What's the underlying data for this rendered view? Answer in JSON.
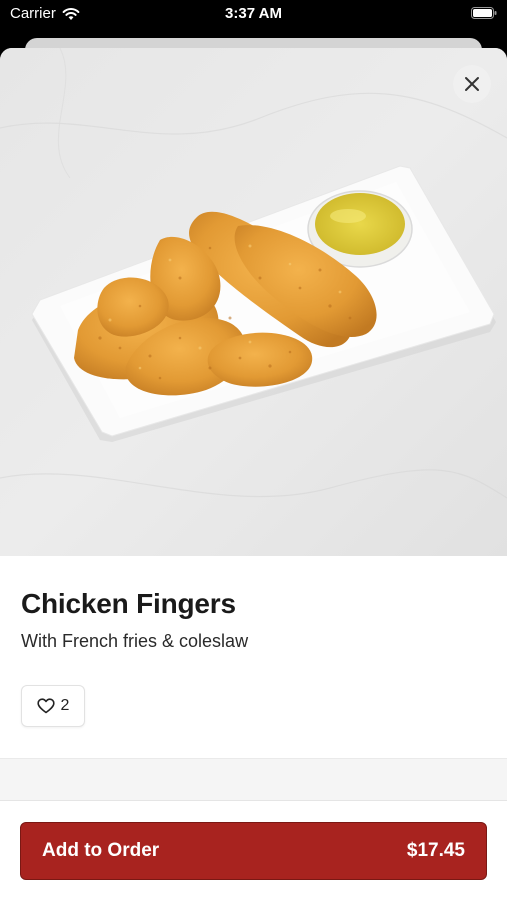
{
  "status_bar": {
    "carrier": "Carrier",
    "time": "3:37 AM"
  },
  "item": {
    "name": "Chicken Fingers",
    "description": "With French fries & coleslaw",
    "likes": "2",
    "image_subject": "chicken fingers on a white rectangular plate with a dipping sauce cup"
  },
  "order": {
    "button_label": "Add to Order",
    "price": "$17.45"
  },
  "colors": {
    "accent": "#a8231f",
    "background": "#ffffff",
    "band": "#f5f5f5"
  },
  "icons": {
    "close": "close-icon",
    "like": "heart-icon",
    "wifi": "wifi-icon",
    "battery": "battery-icon"
  }
}
